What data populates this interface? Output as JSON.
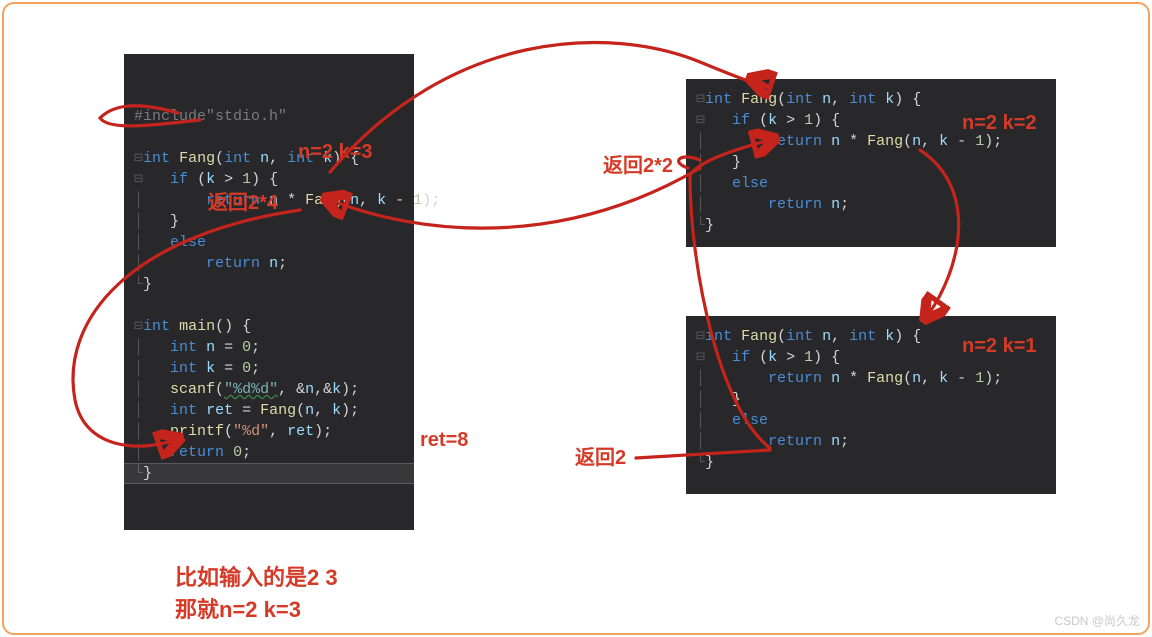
{
  "colors": {
    "annotation": "#d63a27",
    "code_bg": "#28272a",
    "border": "#f5a25d"
  },
  "code": {
    "left": {
      "include": "#include\"stdio.h\"",
      "l1": "int Fang(int n, int k) {",
      "l2": "    if (k > 1) {",
      "l3": "        return n * Fang(n, k - 1);",
      "l4": "    }",
      "l5": "    else",
      "l6": "        return n;",
      "l7": "}",
      "m1": "int main() {",
      "m2": "    int n = 0;",
      "m3": "    int k = 0;",
      "m4": "    scanf(\"%d%d\", &n,&k);",
      "m5": "    int ret = Fang(n, k);",
      "m6": "    printf(\"%d\", ret);",
      "m7": "    return 0;",
      "m8": "}"
    },
    "right1": {
      "l1": "int Fang(int n, int k) {",
      "l2": "    if (k > 1) {",
      "l3": "        return n * Fang(n, k - 1);",
      "l4": "    }",
      "l5": "    else",
      "l6": "        return n;",
      "l7": "}"
    },
    "right2": {
      "l1": "int Fang(int n, int k) {",
      "l2": "    if (k > 1) {",
      "l3": "        return n * Fang(n, k - 1);",
      "l4": "    }",
      "l5": "    else",
      "l6": "        return n;",
      "l7": "}"
    }
  },
  "annotations": {
    "nk_left": "n=2 k=3",
    "ret24": "返回2*4",
    "ret_eq": "ret=8",
    "nk_r1": "n=2 k=2",
    "ret22": "返回2*2",
    "nk_r2": "n=2 k=1",
    "ret2": "返回2",
    "bottom1": "比如输入的是2 3",
    "bottom2": "那就n=2  k=3"
  },
  "watermark": "CSDN @尚久龙"
}
